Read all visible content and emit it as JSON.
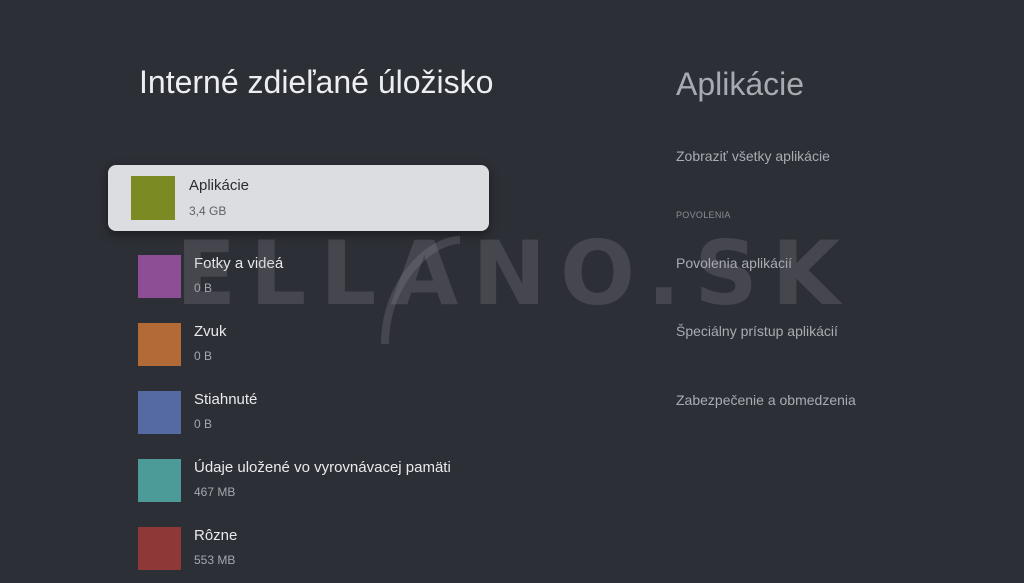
{
  "left_pane": {
    "title": "Interné zdieľané úložisko",
    "items": [
      {
        "name": "Aplikácie",
        "size": "3,4 GB",
        "color": "#7b8a22",
        "focused": true
      },
      {
        "name": "Fotky a videá",
        "size": "0 B",
        "color": "#8e4e96"
      },
      {
        "name": "Zvuk",
        "size": "0 B",
        "color": "#b26a36"
      },
      {
        "name": "Stiahnuté",
        "size": "0 B",
        "color": "#556aa3"
      },
      {
        "name": "Údaje uložené vo vyrovnávacej pamäti",
        "size": "467 MB",
        "color": "#4c9b98"
      },
      {
        "name": "Rôzne",
        "size": "553 MB",
        "color": "#8f3838"
      }
    ]
  },
  "right_pane": {
    "title": "Aplikácie",
    "show_all": "Zobraziť všetky aplikácie",
    "section_header": "POVOLENIA",
    "permissions": "Povolenia aplikácií",
    "special_access": "Špeciálny prístup aplikácií",
    "security": "Zabezpečenie a obmedzenia"
  },
  "watermark": {
    "text": "ELLANO.SK"
  },
  "colors": {
    "background": "#2d2f36",
    "focus_card": "#dcdde0"
  }
}
